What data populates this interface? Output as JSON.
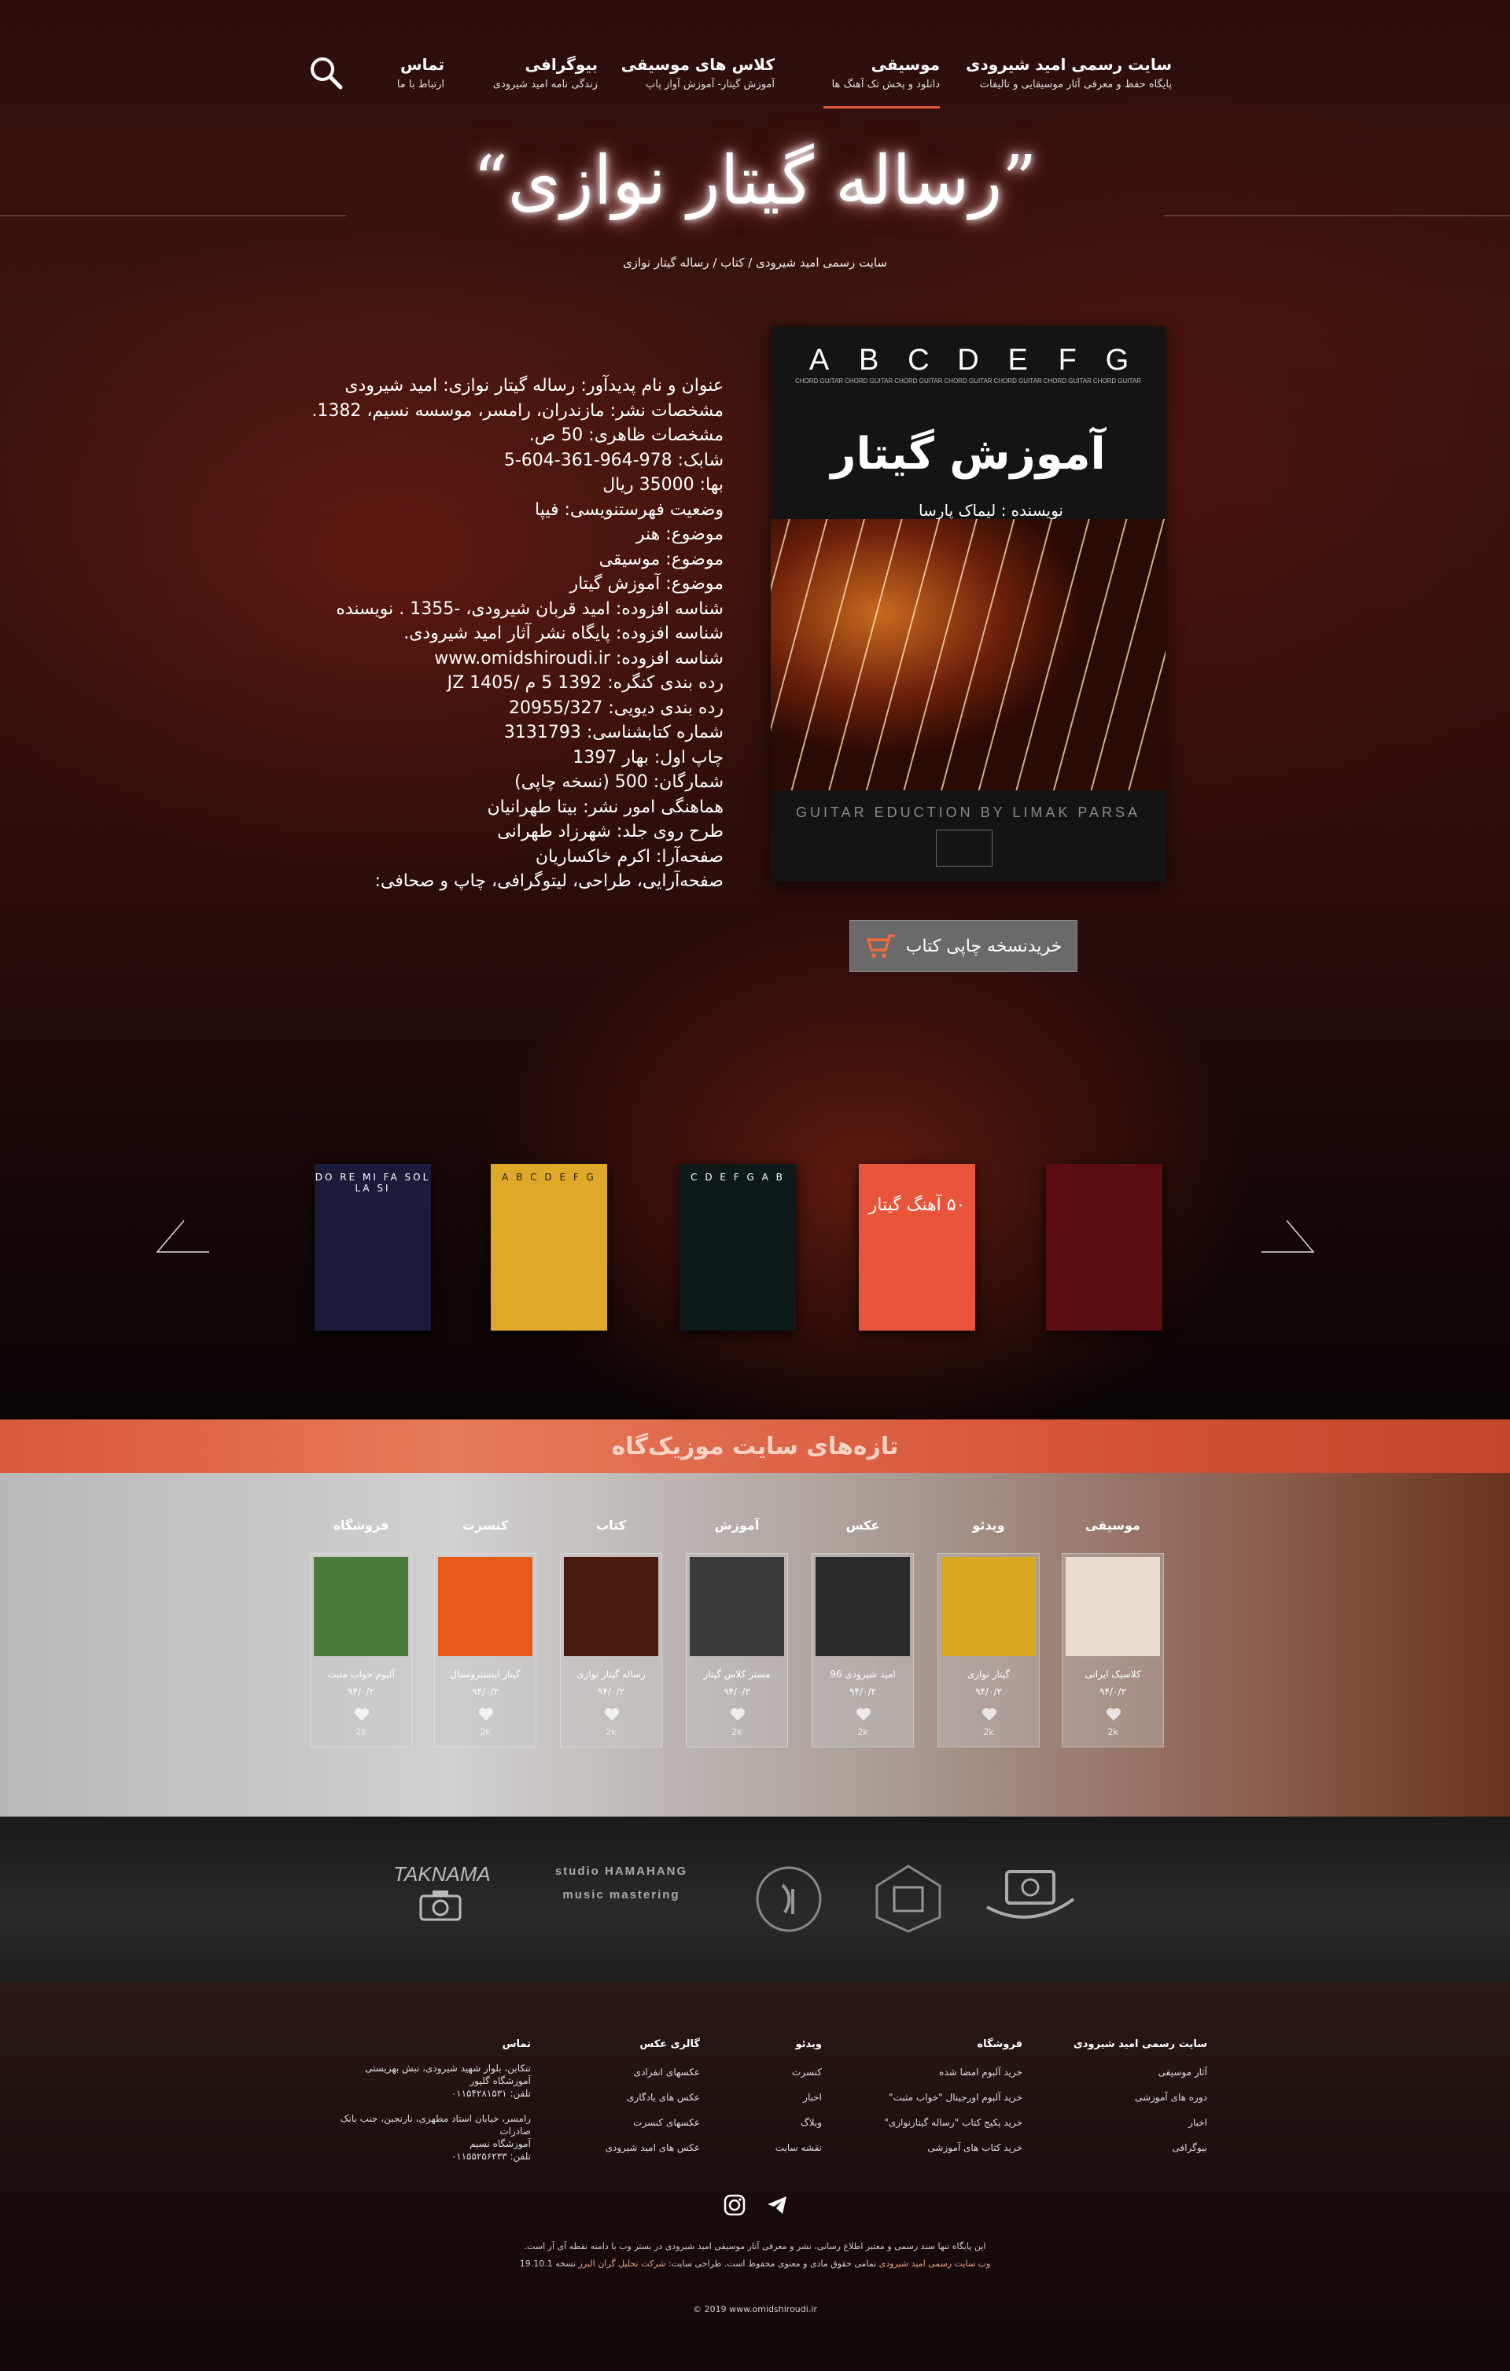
{
  "nav": {
    "items": [
      {
        "title": "سایت رسمی امید شیرودی",
        "sub": "پایگاه حفظ و معرفی آثار موسیقایی و تالیفات"
      },
      {
        "title": "موسیقی",
        "sub": "دانلود و پخش تک آهنگ ها"
      },
      {
        "title": "کلاس های موسیقی",
        "sub": "آموزش گیتار- آموزش آواز پاپ"
      },
      {
        "title": "بیوگرافی",
        "sub": "زندگی نامه امید شیرودی"
      },
      {
        "title": "تماس",
        "sub": "ارتباط با ما"
      }
    ]
  },
  "page": {
    "title": "”رساله گیتار نوازی“",
    "breadcrumb": "سایت رسمی امید شیرودی / کتاب / رساله گیتار نوازی"
  },
  "details": [
    "عنوان و نام پدیدآور: رساله گیتار نوازی: امید شیرودی",
    "مشخصات نشر: مازندران، رامسر، موسسه نسیم، 1382.",
    "مشخصات ظاهری: 50 ص.",
    "شابک: 978-964-361-604-5",
    "بها: 35000 ریال",
    "وضعیت فهرستنویسی: فیپا",
    "موضوع: هنر",
    "موضوع: موسیقی",
    "موضوع: آموزش گیتار",
    "شناسه افزوده: امید قربان شیرودی، -1355 . نویسنده",
    "شناسه افزوده: پایگاه نشر آثار امید شیرودی.",
    "شناسه افزوده: www.omidshiroudi.ir",
    "رده بندی کنگره: 1392 5 م /JZ 1405",
    "رده بندی دیویی: 20955/327",
    "شماره کتابشناسی: 3131793",
    "چاپ اول: بهار 1397",
    "شمارگان: 500 (نسخه چاپی)",
    "هماهنگی امور نشر: بیتا طهرانیان",
    "طرح روی جلد: شهرزاد طهرانی",
    "صفحه‌آرا: اکرم خاکساریان",
    "صفحه‌آرایی، طراحی، لیتوگرافی، چاپ و صحافی:"
  ],
  "cover": {
    "letters": [
      "A",
      "B",
      "C",
      "D",
      "E",
      "F",
      "G"
    ],
    "letter_sub": "CHORD GUITAR",
    "title": "آموزش گیتار",
    "author": "نویسنده : لیماک پارسا",
    "subtitle": "GUITAR EDUCTION BY LIMAK PARSA"
  },
  "buy_button": {
    "label": "خریدنسخه چاپی کتاب"
  },
  "carousel": {
    "items": [
      {
        "label": "DO RE MI FA SOL LA SI",
        "color": "#1a1a3a"
      },
      {
        "label": "A B C D E F G",
        "color": "#e0a828"
      },
      {
        "label": "C D E F G A B",
        "color": "#0e1a1a"
      },
      {
        "label": "۵۰ آهنگ گیتار",
        "color": "#e8553a"
      },
      {
        "label": "",
        "color": "#5a0c10"
      }
    ]
  },
  "banner": {
    "title": "تازه‌های سایت موزیک‌گاه"
  },
  "latest": {
    "cards": [
      {
        "cat": "موسیقی",
        "title": "کلاسیک ایرانی",
        "date": "۹۴/۰/۲",
        "count": "2k",
        "color": "#e8dcd0"
      },
      {
        "cat": "ویدئو",
        "title": "گیتار نوازی",
        "date": "۹۴/۰/۲",
        "count": "2k",
        "color": "#d8a820"
      },
      {
        "cat": "عکس",
        "title": "امید شیرودی 96",
        "date": "۹۴/۰/۲",
        "count": "2k",
        "color": "#2a2a2a"
      },
      {
        "cat": "آموزش",
        "title": "مستر کلاس گیتار",
        "date": "۹۴/۰/۲",
        "count": "2k",
        "color": "#3a3a3a"
      },
      {
        "cat": "کتاب",
        "title": "رساله گیتار نوازی",
        "date": "۹۴/۰/۲",
        "count": "2k",
        "color": "#4a1a10"
      },
      {
        "cat": "کنسرت",
        "title": "گیتار اینسترومنتال",
        "date": "۹۴/۰/۲",
        "count": "2k",
        "color": "#e85a1a"
      },
      {
        "cat": "فروشگاه",
        "title": "آلبوم خواب مثبت",
        "date": "۹۴/۰/۲",
        "count": "2k",
        "color": "#4a7a3a"
      }
    ]
  },
  "partners": {
    "names": [
      "TAKNAMA",
      "studio HAMAHANG music mastering",
      "logo",
      "logo",
      "logo"
    ]
  },
  "footer": {
    "columns": [
      {
        "head": "سایت رسمی امید شیرودی",
        "items": [
          "آثار موسیقی",
          "دوره های آموزشی",
          "اخبار",
          "بیوگرافی"
        ]
      },
      {
        "head": "فروشگاه",
        "items": [
          "خرید آلبوم امضا شده",
          "خرید آلبوم اورجینال \"خواب مثبت\"",
          "خرید پکیج کتاب \"رساله گیتارنوازی\"",
          "خرید کتاب های آموزشی"
        ]
      },
      {
        "head": "ویدئو",
        "items": [
          "کنسرت",
          "اخبار",
          "وبلاگ",
          "نقشه سایت"
        ]
      },
      {
        "head": "گالری عکس",
        "items": [
          "عکسهای انفرادی",
          "عکس های یادگاری",
          "عکسهای کنسرت",
          "عکس های امید شیرودی"
        ]
      }
    ],
    "contact": {
      "head": "تماس",
      "lines": [
        "تنکابن، بلوار شهید شیرودی، نبش بهزیستی",
        "آموزشگاه گلپور",
        "تلفن: ۰۱۱۵۴۲۸۱۵۳۱",
        "",
        "رامسر، خیابان استاد مطهری، نارنجبن، جنب بانک صادرات",
        "آموزشگاه نسیم",
        "تلفن: ۰۱۱۵۵۲۵۶۲۳۳"
      ]
    },
    "note1": "این پایگاه تنها سند رسمی و معتبر اطلاع رسانی، نشر و معرفی آثار موسیقی امید شیرودی در بستر وب با دامنه نقطه آی آر است.",
    "note2_a": "وب سایت رسمی امید شیرودی",
    "note2_b": "تمامی حقوق مادی و معنوی محفوظ است. طراحی سایت:",
    "note2_c": "شرکت تحلیل گران البرز",
    "note2_d": "نسخه 19.10.1",
    "copyright": "© 2019 www.omidshiroudi.ir"
  }
}
